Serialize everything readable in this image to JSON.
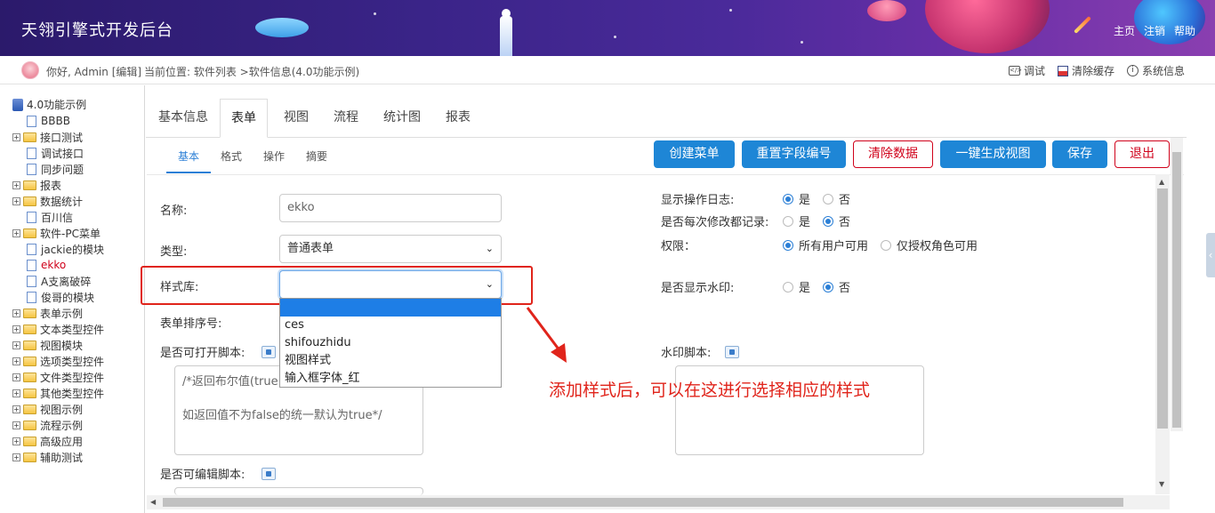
{
  "app": {
    "title": "天翎引擎式开发后台",
    "nav_links": [
      "主页",
      "注销",
      "帮助"
    ]
  },
  "infobar": {
    "greeting": "你好, Admin [编辑]",
    "location": "当前位置: 软件列表 >软件信息(4.0功能示例)",
    "tools": [
      {
        "label": "调试",
        "icon": "debug-icon"
      },
      {
        "label": "清除缓存",
        "icon": "clear-cache-icon"
      },
      {
        "label": "系统信息",
        "icon": "info-icon"
      }
    ]
  },
  "tree": {
    "root": "4.0功能示例",
    "items": [
      {
        "label": "BBBB",
        "type": "file"
      },
      {
        "label": "接口测试",
        "type": "folder"
      },
      {
        "label": "调试接口",
        "type": "file"
      },
      {
        "label": "同步问题",
        "type": "file"
      },
      {
        "label": "报表",
        "type": "folder"
      },
      {
        "label": "数据统计",
        "type": "folder"
      },
      {
        "label": "百川信",
        "type": "file"
      },
      {
        "label": "软件-PC菜单",
        "type": "folder"
      },
      {
        "label": "jackie的模块",
        "type": "file"
      },
      {
        "label": "ekko",
        "type": "file",
        "active": true
      },
      {
        "label": "A支离破碎",
        "type": "file"
      },
      {
        "label": "俊哥的模块",
        "type": "file"
      },
      {
        "label": "表单示例",
        "type": "folder"
      },
      {
        "label": "文本类型控件",
        "type": "folder"
      },
      {
        "label": "视图模块",
        "type": "folder"
      },
      {
        "label": "选项类型控件",
        "type": "folder"
      },
      {
        "label": "文件类型控件",
        "type": "folder"
      },
      {
        "label": "其他类型控件",
        "type": "folder"
      },
      {
        "label": "视图示例",
        "type": "folder"
      },
      {
        "label": "流程示例",
        "type": "folder"
      },
      {
        "label": "高级应用",
        "type": "folder"
      },
      {
        "label": "辅助测试",
        "type": "folder"
      }
    ]
  },
  "tabs": {
    "top": [
      "基本信息",
      "表单",
      "视图",
      "流程",
      "统计图",
      "报表"
    ],
    "active_top": "表单",
    "sub": [
      "基本",
      "格式",
      "操作",
      "摘要"
    ],
    "active_sub": "基本"
  },
  "buttons": {
    "create_menu": "创建菜单",
    "reset_field_no": "重置字段编号",
    "clear_data": "清除数据",
    "gen_view": "一键生成视图",
    "save": "保存",
    "exit": "退出"
  },
  "form": {
    "name_label": "名称:",
    "name_value": "ekko",
    "type_label": "类型:",
    "type_value": "普通表单",
    "style_label": "样式库:",
    "style_value": "",
    "style_options": [
      "",
      "ces",
      "shifouzhidu",
      "视图样式",
      "输入框字体_红"
    ],
    "order_label": "表单排序号:",
    "open_script_label": "是否可打开脚本:",
    "open_script_text": "/*返回布尔值(true",
    "open_script_text2": "如返回值不为false的统一默认为true*/",
    "edit_script_label": "是否可编辑脚本:",
    "watermark_script_label": "水印脚本:",
    "show_log_label": "显示操作日志:",
    "record_label": "是否每次修改都记录:",
    "permission_label": "权限：",
    "watermark_label": "是否显示水印:",
    "yes": "是",
    "no": "否",
    "perm_all": "所有用户可用",
    "perm_role": "仅授权角色可用"
  },
  "annotation": "添加样式后，可以在这进行选择相应的样式",
  "colors": {
    "primary": "#1e86d6",
    "danger": "#d0021b",
    "annotation": "#e0241b",
    "dropdown_highlight": "#1e7ee6"
  }
}
